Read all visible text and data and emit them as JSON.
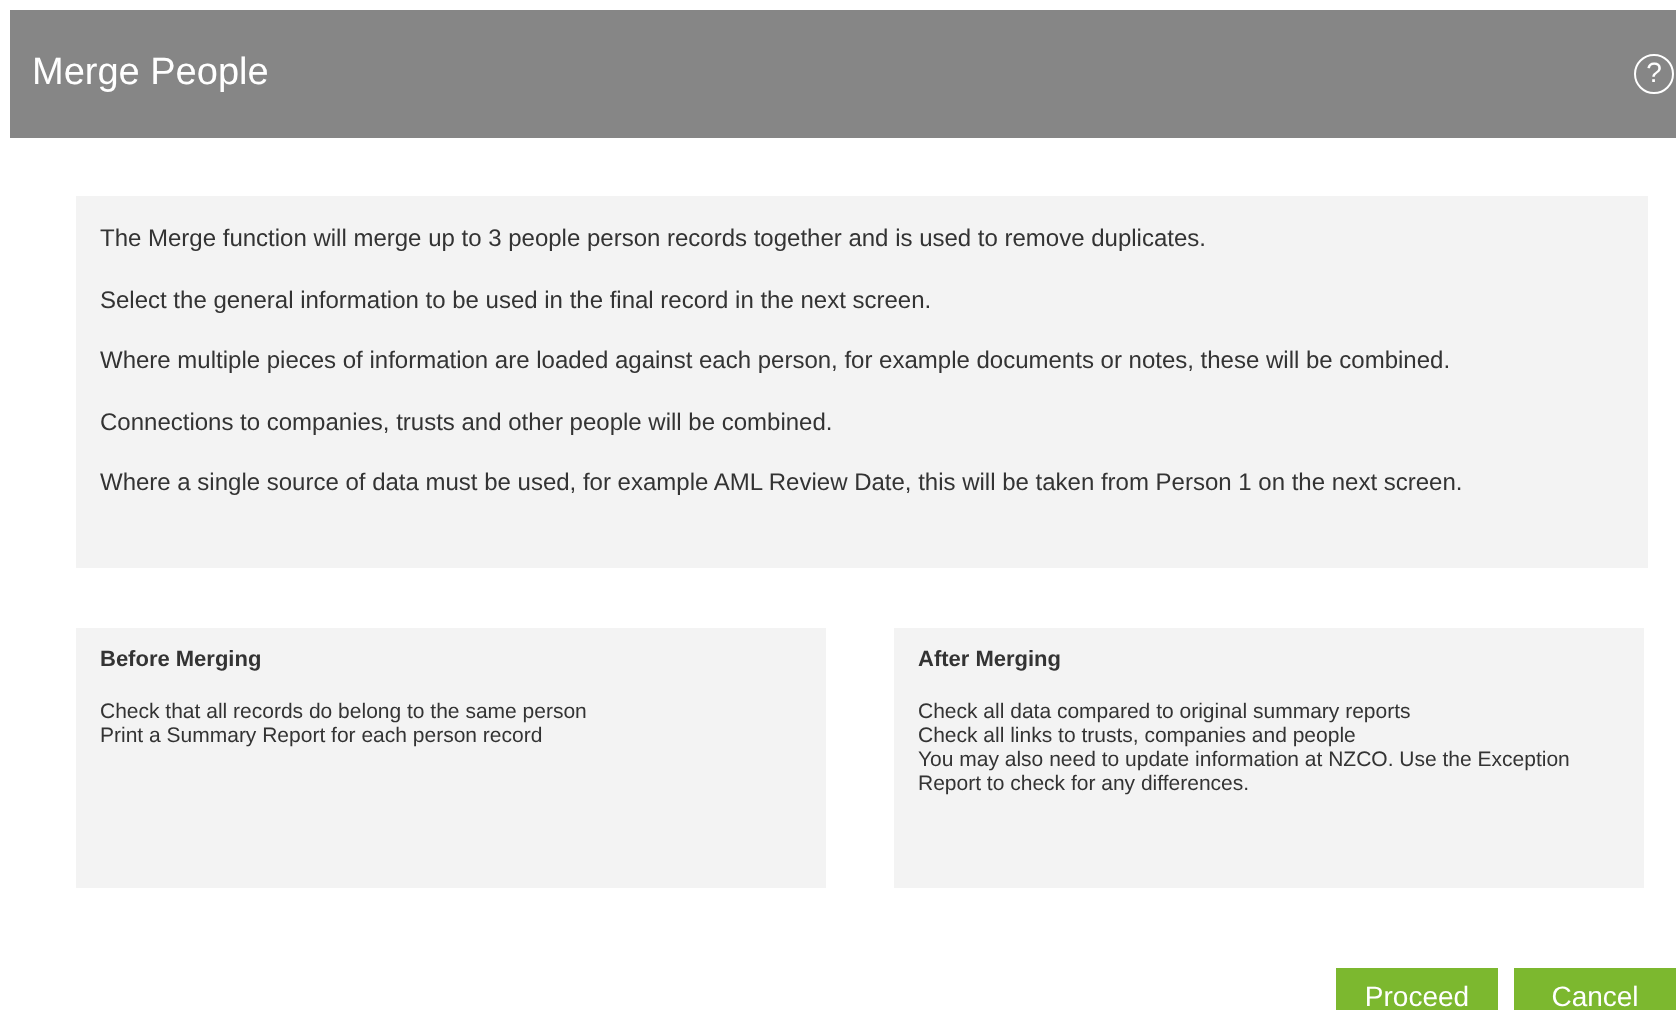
{
  "header": {
    "title": "Merge People",
    "help": "?"
  },
  "intro": [
    "The Merge function will merge up to 3 people person records together and is used to remove duplicates.",
    "Select the general information to be used in the final record in the next screen.",
    "Where multiple pieces of information are loaded against each person, for example documents or notes, these will be combined.",
    "Connections to companies, trusts and other people will be combined.",
    "Where a single source of data must be used, for example AML Review Date, this will be taken from Person 1 on the next screen."
  ],
  "panels": [
    {
      "title": "Before Merging",
      "lines": [
        "Check that all records do belong to the same person",
        "Print a Summary Report for each person record"
      ]
    },
    {
      "title": "After Merging",
      "lines": [
        "Check all data compared to original summary reports",
        "Check all links to trusts, companies and people",
        "You may also need to update information at NZCO.  Use the Exception Report to check for any differences."
      ]
    }
  ],
  "buttons": [
    "Proceed",
    "Cancel"
  ]
}
